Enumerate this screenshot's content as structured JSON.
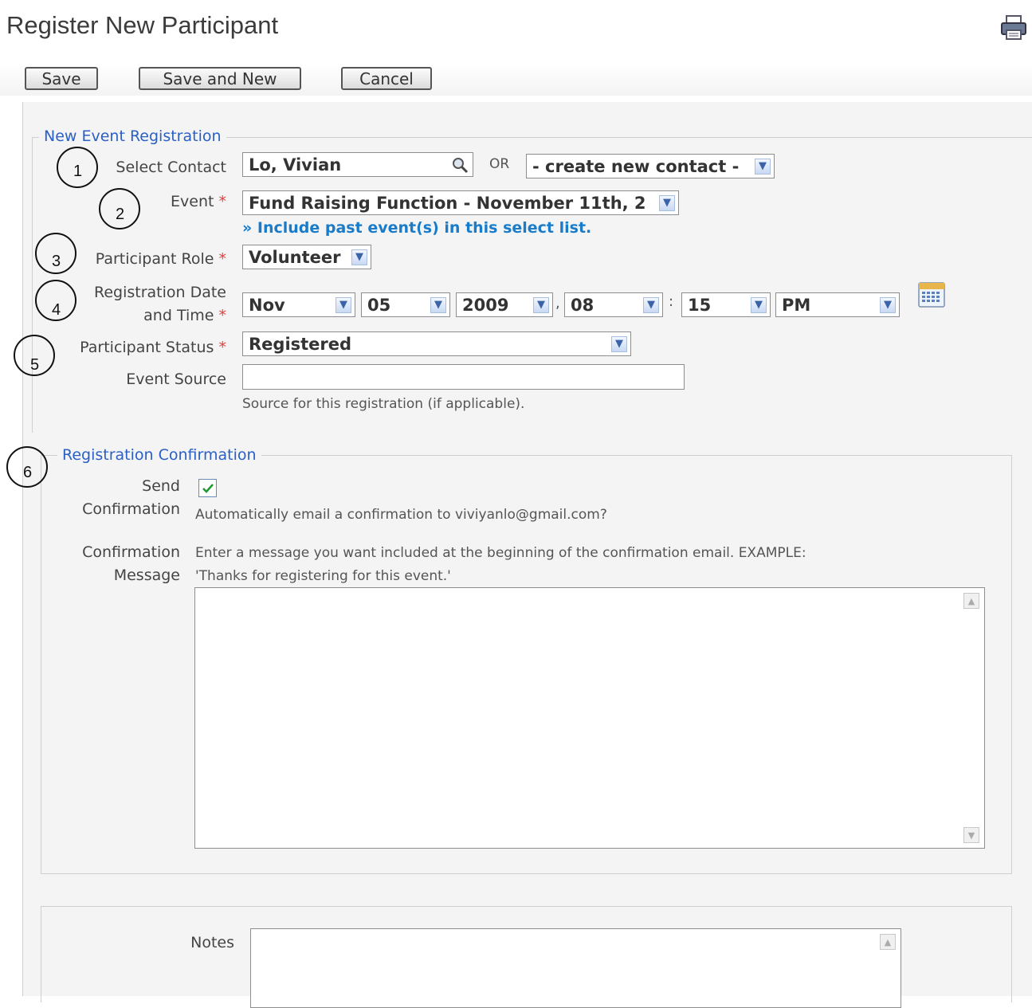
{
  "page": {
    "title": "Register New Participant",
    "print_icon": "printer-icon"
  },
  "toolbar": {
    "save": "Save",
    "save_and_new": "Save and New",
    "cancel": "Cancel"
  },
  "registration": {
    "legend": "New Event Registration",
    "select_contact": {
      "label": "Select Contact",
      "value": "Lo, Vivian",
      "or": "OR",
      "new_contact": "- create new contact -"
    },
    "event": {
      "label": "Event",
      "value": "Fund Raising Function - November 11th, 2",
      "include_past": "» Include past event(s) in this select list."
    },
    "role": {
      "label": "Participant Role",
      "value": "Volunteer"
    },
    "date": {
      "label_1": "Registration Date",
      "label_2": "and Time",
      "month": "Nov",
      "day": "05",
      "year": "2009",
      "sep1": ",",
      "hour": "08",
      "sep2": ":",
      "minute": "15",
      "ampm": "PM"
    },
    "status": {
      "label": "Participant Status",
      "value": "Registered"
    },
    "source": {
      "label": "Event Source",
      "value": "",
      "help": "Source for this registration (if applicable)."
    },
    "required_mark": "*"
  },
  "confirmation": {
    "legend": "Registration Confirmation",
    "send_label_1": "Send",
    "send_label_2": "Confirmation",
    "send_checked": true,
    "send_help": "Automatically email a confirmation to viviyanlo@gmail.com?",
    "message_label_1": "Confirmation",
    "message_label_2": "Message",
    "message_help_1": "Enter a message you want included at the beginning of the confirmation email. EXAMPLE:",
    "message_help_2": "'Thanks for registering for this event.'",
    "message_value": ""
  },
  "notes": {
    "label": "Notes",
    "value": ""
  },
  "annotations": [
    "1",
    "2",
    "3",
    "4",
    "5",
    "6"
  ],
  "colors": {
    "legend": "#2a5fc5",
    "required": "#e04040",
    "link": "#1a7bc8",
    "panel": "#f4f4f4"
  }
}
